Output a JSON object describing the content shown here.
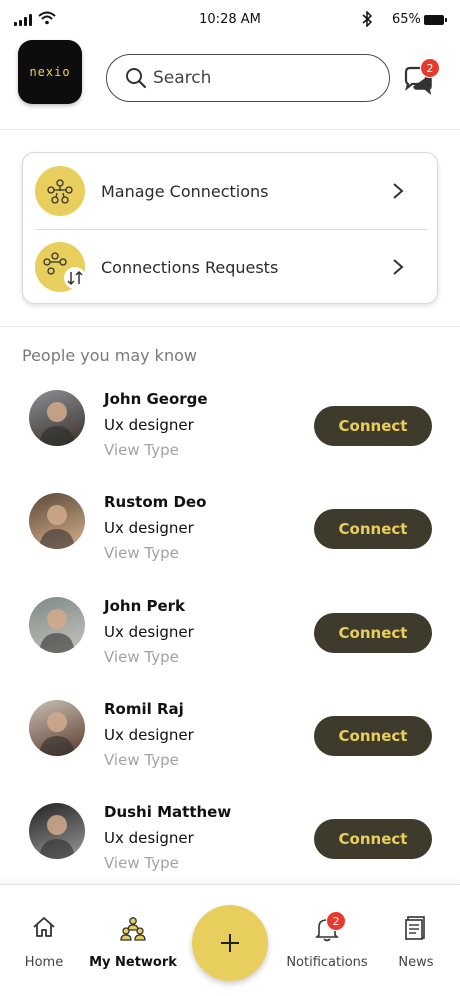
{
  "status_bar": {
    "time": "10:28 AM",
    "battery": "65%"
  },
  "header": {
    "logo_text": "nexio",
    "search_placeholder": "Search",
    "messages_badge": "2"
  },
  "manage": {
    "items": [
      {
        "label": "Manage Connections",
        "icon": "network-people-icon"
      },
      {
        "label": "Connections Requests",
        "icon": "connection-requests-icon"
      }
    ]
  },
  "people_section": {
    "title": "People you may know",
    "connect_label": "Connect",
    "people": [
      {
        "name": "John George",
        "role": "Ux designer",
        "link": "View Type",
        "avatar_colors": [
          "#8a8f96",
          "#3a3026"
        ]
      },
      {
        "name": "Rustom Deo",
        "role": "Ux designer",
        "link": "View Type",
        "avatar_colors": [
          "#5a4a3a",
          "#d9b08c"
        ]
      },
      {
        "name": "John Perk",
        "role": "Ux designer",
        "link": "View Type",
        "avatar_colors": [
          "#7c8a86",
          "#c8c4bc"
        ]
      },
      {
        "name": "Romil Raj",
        "role": "Ux designer",
        "link": "View Type",
        "avatar_colors": [
          "#c8c0b4",
          "#5a3a2c"
        ]
      },
      {
        "name": "Dushi Matthew",
        "role": "Ux designer",
        "link": "View Type",
        "avatar_colors": [
          "#222222",
          "#9a9a9a"
        ]
      }
    ]
  },
  "bottom_nav": {
    "home": "Home",
    "network": "My Network",
    "notifications": "Notifications",
    "notifications_badge": "2",
    "news": "News"
  },
  "colors": {
    "accent_yellow": "#e8cf5d",
    "button_dark": "#3e3a2c",
    "badge_red": "#e53b2c"
  }
}
